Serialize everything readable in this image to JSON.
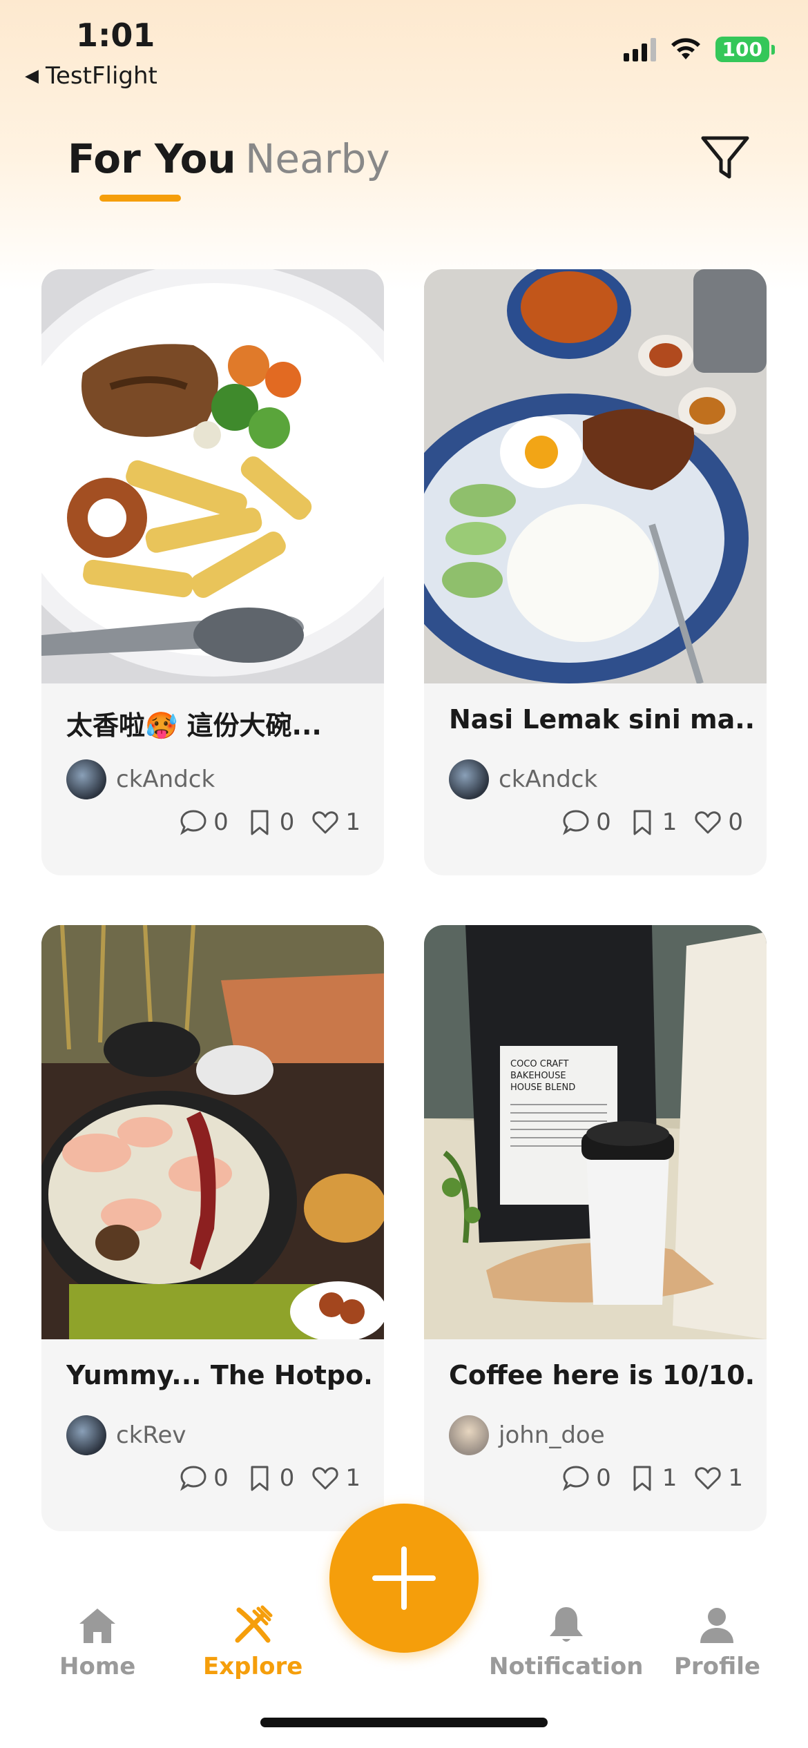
{
  "status_bar": {
    "time": "1:01",
    "back_app": "TestFlight",
    "battery": "100"
  },
  "tabs": [
    {
      "label": "For You",
      "active": true
    },
    {
      "label": "Nearby",
      "active": false
    }
  ],
  "posts": [
    {
      "title": "太香啦🥵 這份大碗...",
      "author": "ckAndck",
      "comments": "0",
      "bookmarks": "0",
      "likes": "1",
      "image": "chicken-pasta-plate"
    },
    {
      "title": "Nasi Lemak sini ma...",
      "author": "ckAndck",
      "comments": "0",
      "bookmarks": "1",
      "likes": "0",
      "image": "nasi-lemak-plate"
    },
    {
      "title": "Yummy... The Hotpo...",
      "author": "ckRev",
      "comments": "0",
      "bookmarks": "0",
      "likes": "1",
      "image": "hotpot"
    },
    {
      "title": "Coffee here is 10/10...",
      "author": "john_doe",
      "comments": "0",
      "bookmarks": "1",
      "likes": "1",
      "image": "coffee-bag-cup"
    }
  ],
  "coffee_bag_text": "COCO CRAFT BAKEHOUSE HOUSE BLEND",
  "nav": {
    "home": "Home",
    "explore": "Explore",
    "notification": "Notification",
    "profile": "Profile"
  },
  "colors": {
    "accent": "#f59e0b",
    "battery": "#34c759"
  }
}
